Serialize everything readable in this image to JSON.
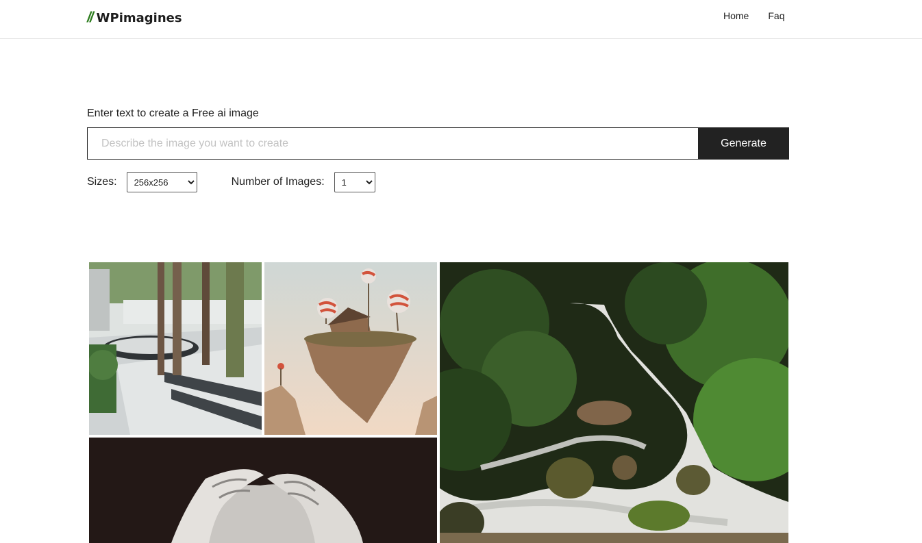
{
  "header": {
    "logo_mark": "//",
    "logo_text": "WPimagines",
    "nav": [
      "Home",
      "Faq"
    ]
  },
  "form": {
    "label": "Enter text to create a Free ai image",
    "placeholder": "Describe the image you want to create",
    "value": "",
    "generate_label": "Generate",
    "sizes_label": "Sizes:",
    "size_selected": "256x256",
    "count_label": "Number of Images:",
    "count_selected": "1"
  },
  "gallery": {
    "images": [
      {
        "subject": "courtyard with tall trees and shadows"
      },
      {
        "subject": "floating island with house and lollipop trees"
      },
      {
        "subject": "hands holding an object in black and white"
      },
      {
        "subject": "forest stream with mossy rocks"
      }
    ]
  },
  "colors": {
    "accent_green": "#2e7d1f",
    "button_dark": "#222222"
  }
}
